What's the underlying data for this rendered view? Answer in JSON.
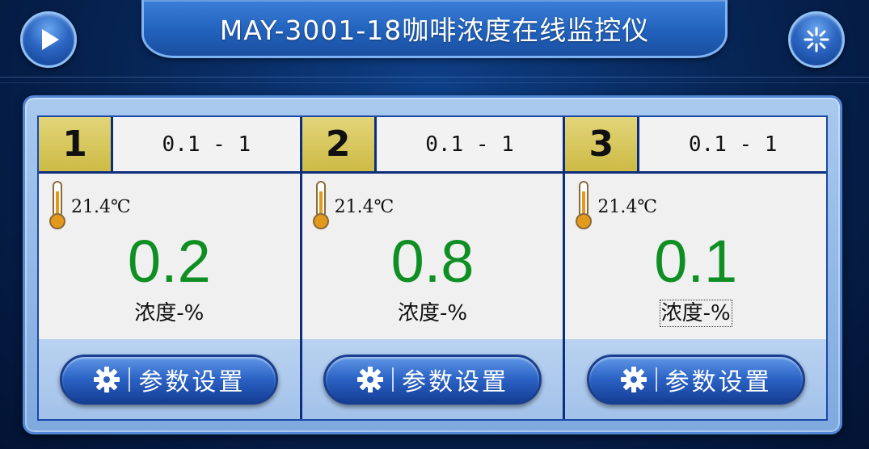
{
  "header": {
    "title": "MAY-3001-18咖啡浓度在线监控仪",
    "play_icon": "play-icon",
    "settings_icon": "snowflake-settings-icon"
  },
  "channels": [
    {
      "number": "1",
      "range": "0.1 - 1",
      "temperature": "21.4℃",
      "value": "0.2",
      "unit": "浓度-%",
      "button_label": "参数设置"
    },
    {
      "number": "2",
      "range": "0.1 - 1",
      "temperature": "21.4℃",
      "value": "0.8",
      "unit": "浓度-%",
      "button_label": "参数设置"
    },
    {
      "number": "3",
      "range": "0.1 - 1",
      "temperature": "21.4℃",
      "value": "0.1",
      "unit": "浓度-%",
      "button_label": "参数设置"
    }
  ],
  "colors": {
    "value_green": "#0f8f23",
    "number_gold": "#cdbb45",
    "panel_blue": "#0c2e7c"
  }
}
